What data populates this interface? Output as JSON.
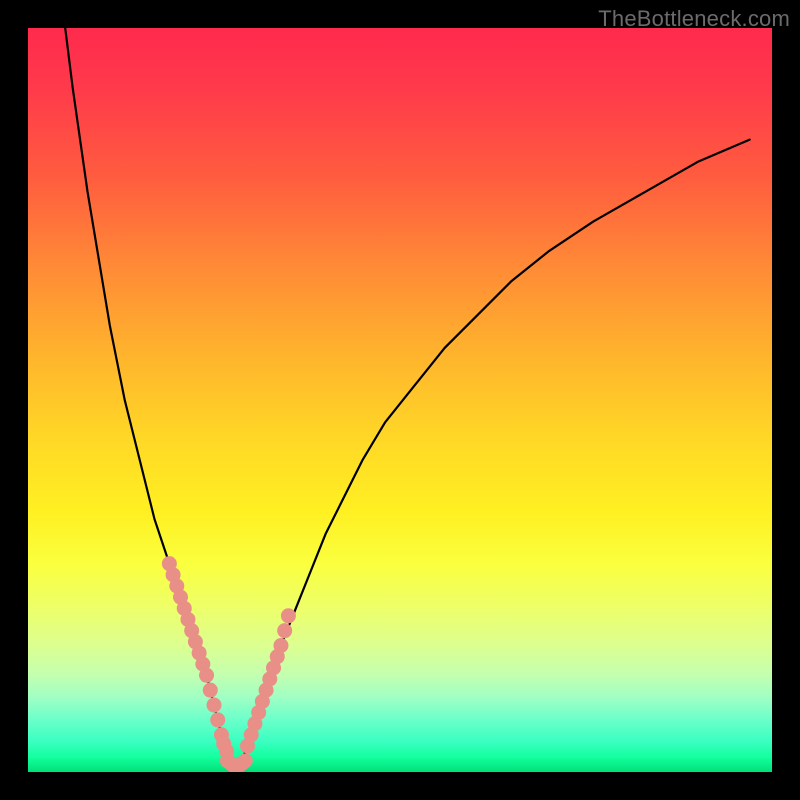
{
  "watermark": "TheBottleneck.com",
  "chart_data": {
    "type": "line",
    "title": "",
    "xlabel": "",
    "ylabel": "",
    "xlim": [
      0,
      100
    ],
    "ylim": [
      0,
      100
    ],
    "grid": false,
    "legend": false,
    "series": [
      {
        "name": "curve-left",
        "x": [
          5,
          6,
          7,
          8,
          9,
          10,
          11,
          12,
          13,
          14,
          15,
          16,
          17,
          18,
          19,
          20,
          21,
          22,
          23,
          24,
          24.5,
          25,
          25.5,
          26,
          26.5,
          27,
          27.5,
          28
        ],
        "values": [
          100,
          92,
          85,
          78,
          72,
          66,
          60,
          55,
          50,
          46,
          42,
          38,
          34,
          31,
          28,
          25,
          22,
          19,
          16,
          13,
          11,
          9,
          7,
          5,
          3.5,
          2.2,
          1.2,
          0.5
        ]
      },
      {
        "name": "curve-right",
        "x": [
          28,
          28.5,
          29,
          29.5,
          30,
          31,
          32,
          33,
          34,
          36,
          38,
          40,
          42,
          45,
          48,
          52,
          56,
          60,
          65,
          70,
          76,
          83,
          90,
          97
        ],
        "values": [
          0.5,
          1.2,
          2.2,
          3.5,
          5,
          8,
          11,
          14,
          17,
          22,
          27,
          32,
          36,
          42,
          47,
          52,
          57,
          61,
          66,
          70,
          74,
          78,
          82,
          85
        ]
      },
      {
        "name": "marker-cluster-left",
        "style": "dots",
        "x": [
          19,
          19.5,
          20,
          20.5,
          21,
          21.5,
          22,
          22.5,
          23,
          23.5,
          24,
          24.5,
          25,
          25.5,
          26,
          26.3,
          26.7
        ],
        "values": [
          28,
          26.5,
          25,
          23.5,
          22,
          20.5,
          19,
          17.5,
          16,
          14.5,
          13,
          11,
          9,
          7,
          5,
          3.8,
          2.8
        ]
      },
      {
        "name": "marker-cluster-right",
        "style": "dots",
        "x": [
          29.5,
          30,
          30.5,
          31,
          31.5,
          32,
          32.5,
          33,
          33.5,
          34,
          34.5,
          35
        ],
        "values": [
          3.5,
          5,
          6.5,
          8,
          9.5,
          11,
          12.5,
          14,
          15.5,
          17,
          19,
          21
        ]
      },
      {
        "name": "bottom-cluster",
        "style": "dots",
        "x": [
          26.8,
          27.2,
          27.6,
          28,
          28.4,
          28.8,
          29.2
        ],
        "values": [
          1.5,
          1.2,
          0.9,
          0.8,
          0.9,
          1.2,
          1.5
        ]
      }
    ],
    "colors": {
      "curve": "#000000",
      "dots": "#e88f87"
    }
  }
}
